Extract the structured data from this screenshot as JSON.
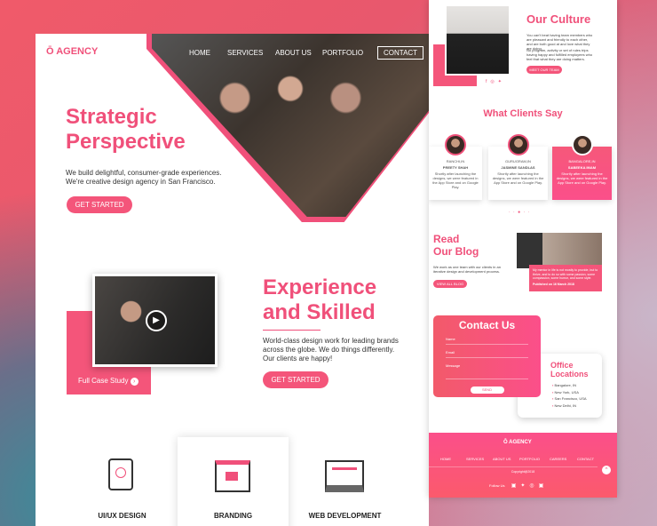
{
  "header": {
    "logo": "AGENCY",
    "nav": [
      "HOME",
      "SERVICES",
      "ABOUT US",
      "PORTFOLIO"
    ],
    "contact": "CONTACT"
  },
  "hero": {
    "title_line1": "Strategic",
    "title_line2": "Perspective",
    "text_line1": "We build delightful, consumer-grade experiences.",
    "text_line2": "We're creative design agency in San Francisco.",
    "button": "GET STARTED"
  },
  "experience": {
    "title_line1": "Experience",
    "title_line2": "and Skilled",
    "text_line1": "World-class design work for leading brands",
    "text_line2": "across the globe. We do things differently.",
    "text_line3": "Our clients are happy!",
    "button": "GET STARTED",
    "case_study": "Full Case Study"
  },
  "services": [
    "UI/UX DESIGN",
    "BRANDING",
    "WEB DEVELOPMENT"
  ],
  "culture": {
    "title": "Our Culture",
    "text1": "You can't beat having team members who are pleasant and friendly to each other, and are both good at and love what they are doing.",
    "text2": "No program, activity or set of rules trips having happy and fulfilled employees who feel that what they are doing matters.",
    "button": "MEET OUR TEAM"
  },
  "clients": {
    "title": "What Clients Say",
    "items": [
      {
        "city": "RANCHI,IN",
        "name": "PREETY SHAH",
        "quote": "Shortly after launching the designs, we were featured in the App Store and on Google Play."
      },
      {
        "city": "GURUGRAM,IN",
        "name": "JASMINE SANDLAS",
        "quote": "Shortly after launching the designs, we were featured in the App Store and on Google Play."
      },
      {
        "city": "BANGALORE,IN",
        "name": "SABEEKA IMAM",
        "quote": "Shortly after launching the designs, we were featured in the App Store and on Google Play."
      }
    ]
  },
  "blog": {
    "title_line1": "Read",
    "title_line2": "Our Blog",
    "text": "We work as one team with our clients in an iterative design and development process.",
    "button": "VIEW ALL BLOG",
    "post": "My mentor in life is not mostly to provide, but to thrive, and to do so with some passion, some compassion, some humor, and some style.",
    "date": "Published on 16 March 2018"
  },
  "contact": {
    "title": "Contact Us",
    "fields": [
      "Name",
      "Email",
      "Message"
    ],
    "button": "SEND"
  },
  "offices": {
    "title_line1": "Office",
    "title_line2": "Locations",
    "items": [
      "Bangalore, IN",
      "New York, USA",
      "San Francisco, USA",
      "New Delhi, IN"
    ]
  },
  "footer": {
    "logo": "AGENCY",
    "nav": [
      "HOME",
      "SERVICES",
      "ABOUT US",
      "PORTFOLIO",
      "CAREERS",
      "CONTACT"
    ],
    "copyright": "Copyright@2018",
    "follow": "Follow Us"
  },
  "colors": {
    "accent": "#f0507a"
  }
}
